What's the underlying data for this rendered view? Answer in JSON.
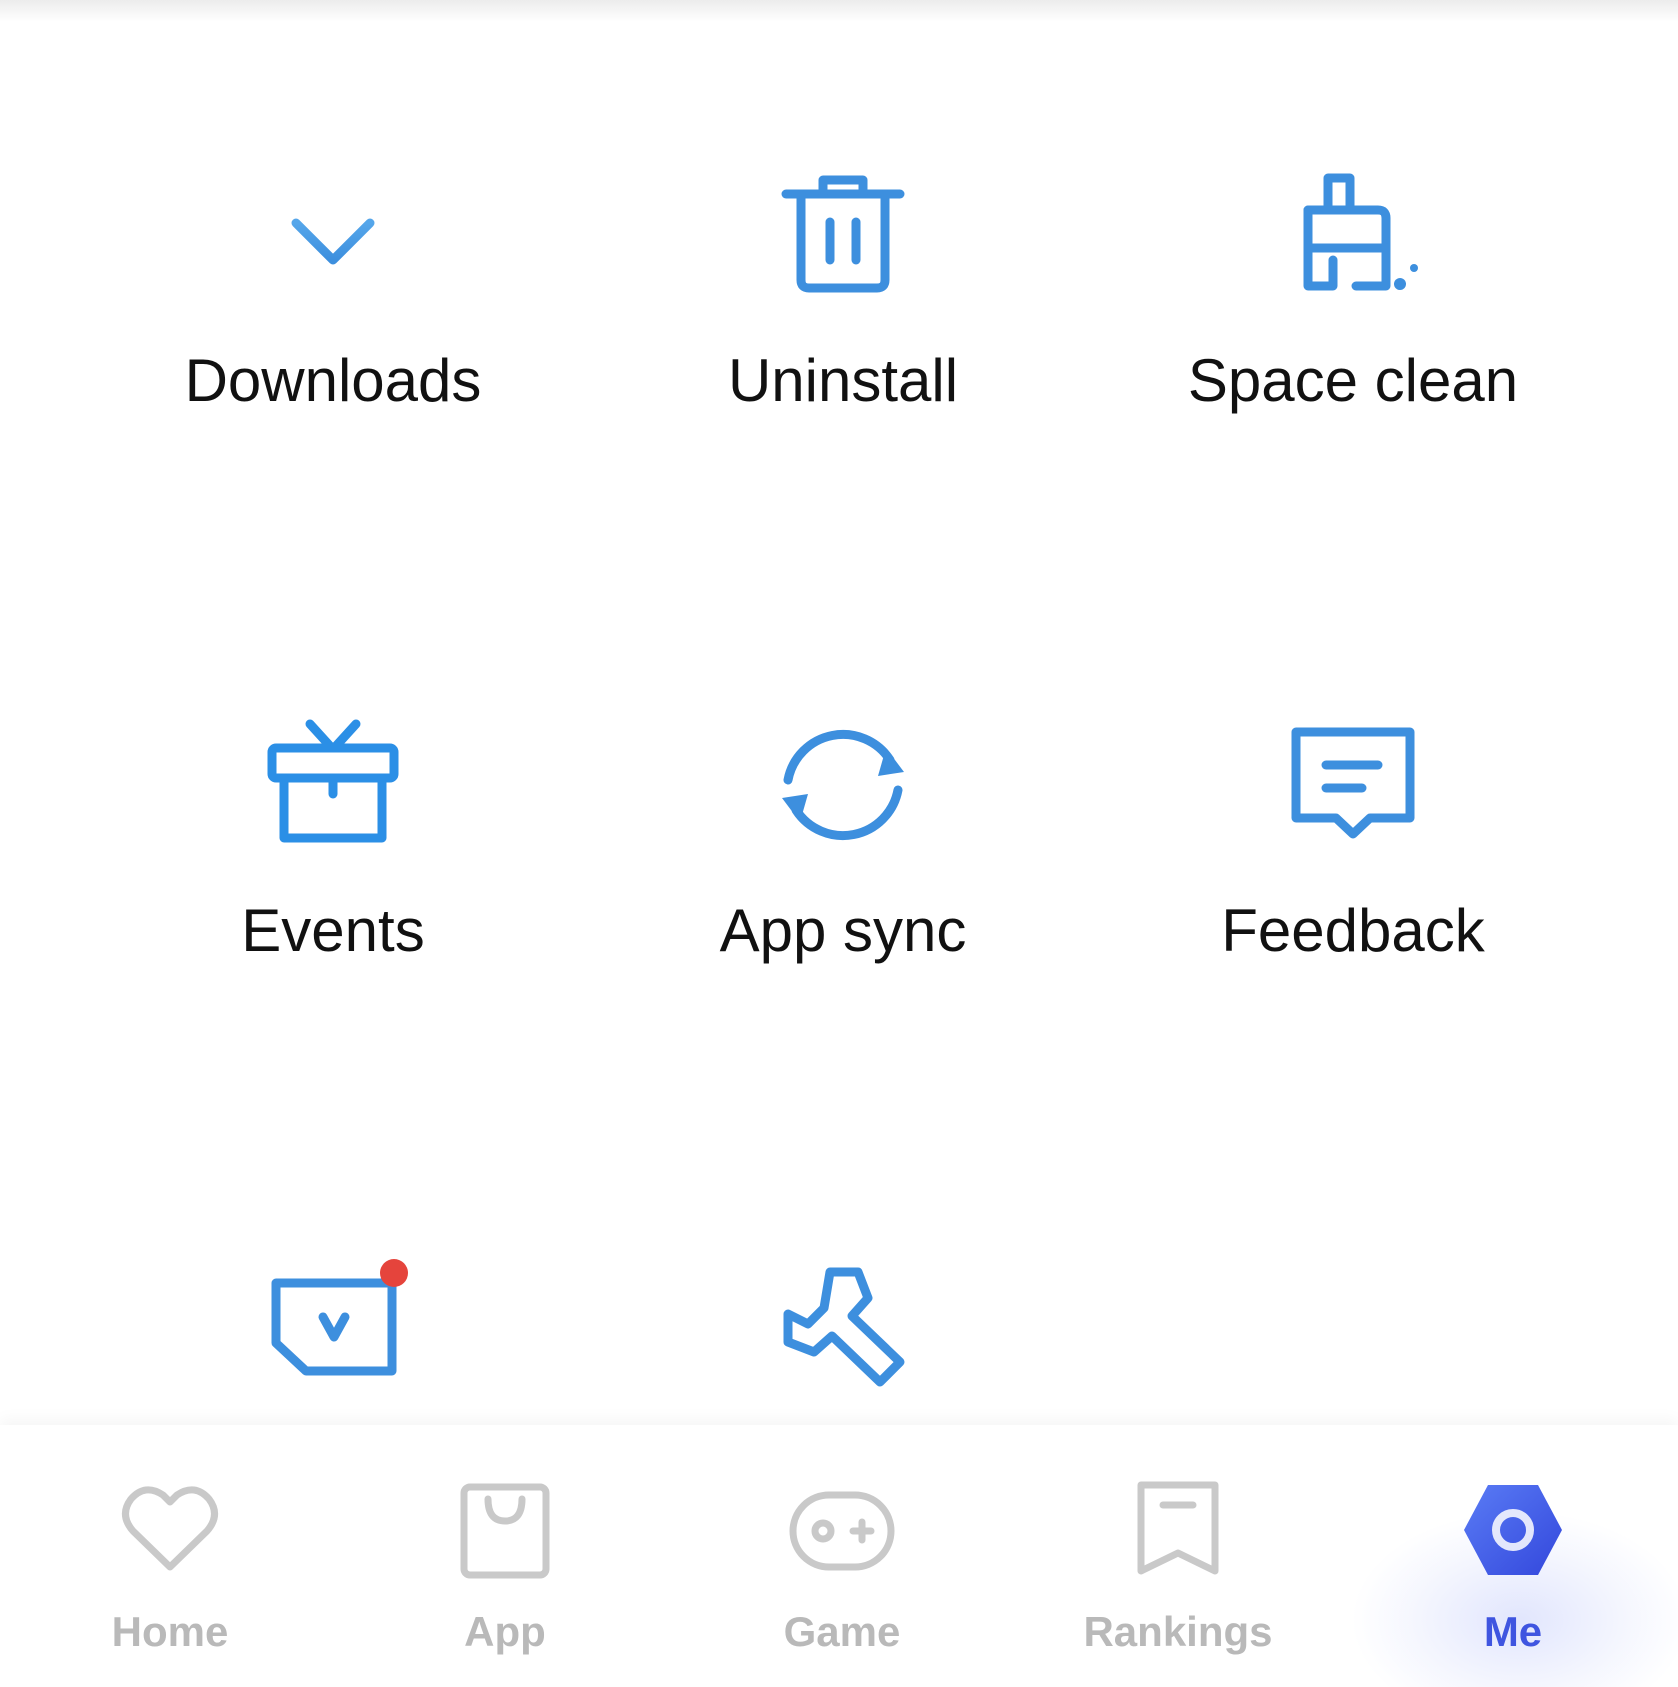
{
  "colors": {
    "icon_blue": "#3d8fde",
    "icon_blue_light": "#55a6ea",
    "label_text": "#111111",
    "nav_inactive": "#b9b9b9",
    "nav_active": "#3f55e0",
    "badge": "#e5443c"
  },
  "tools": [
    {
      "id": "downloads",
      "label": "Downloads",
      "icon": "download-icon"
    },
    {
      "id": "uninstall",
      "label": "Uninstall",
      "icon": "trash-icon"
    },
    {
      "id": "space-clean",
      "label": "Space clean",
      "icon": "brush-icon"
    },
    {
      "id": "events",
      "label": "Events",
      "icon": "gift-icon"
    },
    {
      "id": "app-sync",
      "label": "App sync",
      "icon": "sync-icon"
    },
    {
      "id": "feedback",
      "label": "Feedback",
      "icon": "feedback-icon"
    },
    {
      "id": "tv-tool",
      "label": "",
      "icon": "tv-icon",
      "has_badge": true
    },
    {
      "id": "wrench-tool",
      "label": "",
      "icon": "wrench-icon"
    }
  ],
  "bottom_nav": {
    "items": [
      {
        "label": "Home",
        "icon": "heart-icon",
        "active": false
      },
      {
        "label": "App",
        "icon": "bag-icon",
        "active": false
      },
      {
        "label": "Game",
        "icon": "gamepad-icon",
        "active": false
      },
      {
        "label": "Rankings",
        "icon": "bookmark-icon",
        "active": false
      },
      {
        "label": "Me",
        "icon": "hexagon-icon",
        "active": true
      }
    ]
  }
}
